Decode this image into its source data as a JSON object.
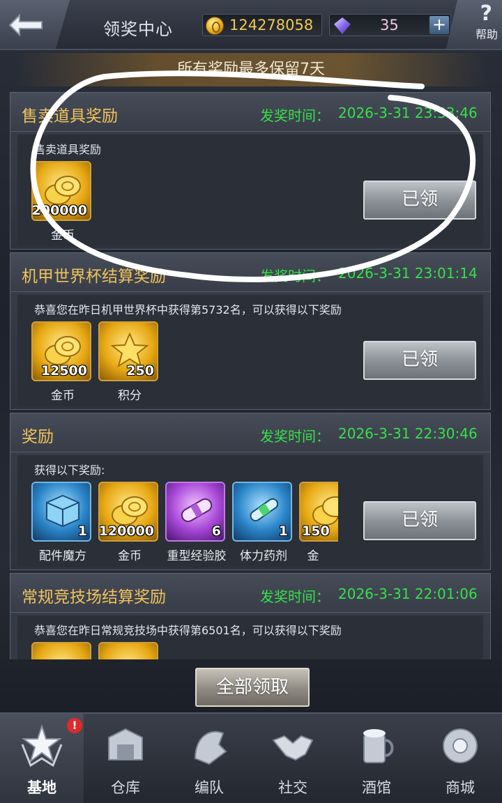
{
  "header": {
    "title": "领奖中心",
    "coins": "124278058",
    "gems": "35",
    "plus": "+",
    "help_q": "?",
    "help_label": "帮助"
  },
  "notice": "所有奖励最多保留7天",
  "time_label": "发奖时间：",
  "claimed_label": "已领",
  "rewards": [
    {
      "title": "售卖道具奖励",
      "time": "2026-3-31 23:33:46",
      "desc": "售卖道具奖励",
      "items": [
        {
          "name": "金币",
          "qty": "200000",
          "icon": "gold-coins-icon"
        }
      ]
    },
    {
      "title": "机甲世界杯结算奖励",
      "time": "2026-3-31 23:01:14",
      "desc": "恭喜您在昨日机甲世界杯中获得第5732名，可以获得以下奖励",
      "items": [
        {
          "name": "金币",
          "qty": "12500",
          "icon": "gold-coins-icon"
        },
        {
          "name": "积分",
          "qty": "250",
          "icon": "star-icon"
        }
      ]
    },
    {
      "title": "奖励",
      "time": "2026-3-31 22:30:46",
      "desc": "获得以下奖励:",
      "items": [
        {
          "name": "配件魔方",
          "qty": "1",
          "icon": "cube-icon"
        },
        {
          "name": "金币",
          "qty": "120000",
          "icon": "gold-coins-icon"
        },
        {
          "name": "重型经验胶",
          "qty": "6",
          "icon": "capsule-icon"
        },
        {
          "name": "体力药剂",
          "qty": "1",
          "icon": "potion-icon"
        },
        {
          "name": "金",
          "qty": "150",
          "icon": "gold-coins-icon"
        }
      ]
    },
    {
      "title": "常规竞技场结算奖励",
      "time": "2026-3-31 22:01:06",
      "desc": "恭喜您在昨日常规竞技场中获得第6501名，可以获得以下奖励"
    }
  ],
  "claim_all": "全部领取",
  "nav": [
    {
      "label": "基地",
      "icon": "base-icon",
      "badge": "!"
    },
    {
      "label": "仓库",
      "icon": "warehouse-icon"
    },
    {
      "label": "编队",
      "icon": "formation-icon"
    },
    {
      "label": "社交",
      "icon": "handshake-icon"
    },
    {
      "label": "酒馆",
      "icon": "tavern-icon"
    },
    {
      "label": "商城",
      "icon": "shop-icon"
    }
  ],
  "colors": {
    "title_gold": "#f1c35a",
    "time_green": "#36e04a",
    "coin_gold": "#f2c94c"
  }
}
